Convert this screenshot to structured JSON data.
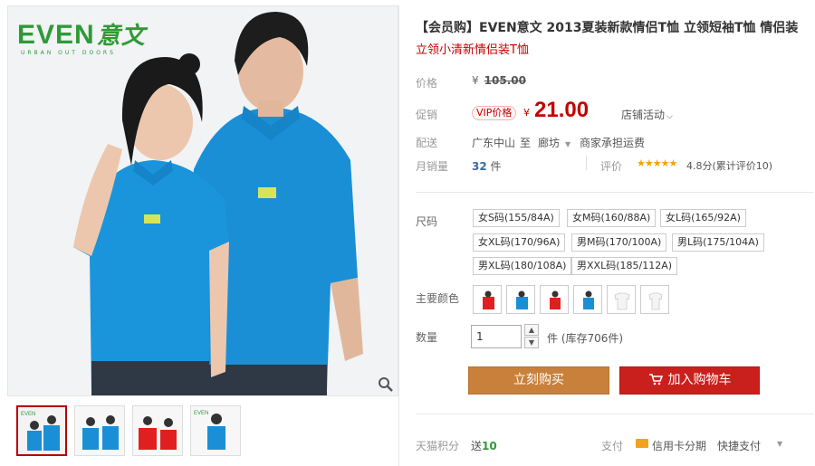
{
  "gallery": {
    "brand_logo": "EVEN",
    "brand_logo_cn": "意文",
    "brand_sub": "URBAN OUT DOORS"
  },
  "product": {
    "title": "【会员购】EVEN意文 2013夏装新款情侣T恤 立领短袖T恤 情侣装",
    "subtitle": "立领小清新情侣装T恤"
  },
  "price": {
    "label": "价格",
    "currency": "¥",
    "original": "105.00",
    "promo_label": "促销",
    "vip_badge": "VIP价格",
    "vip_currency": "¥",
    "current": "21.00",
    "promo_dropdown": "店铺活动"
  },
  "shipping": {
    "label": "配送",
    "from": "广东中山",
    "to_word": "至",
    "to": "廊坊",
    "carrier": "商家承担运费"
  },
  "sales": {
    "label": "月销量",
    "count": "32",
    "unit": "件",
    "review_label": "评价",
    "stars": "★★★★★",
    "rating_text": "4.8分(累计评价10)"
  },
  "size": {
    "label": "尺码",
    "options": [
      "女S码(155/84A)",
      "女M码(160/88A)",
      "女L码(165/92A)",
      "女XL码(170/96A)",
      "男M码(170/100A)",
      "男L码(175/104A)",
      "男XL码(180/108A)",
      "男XXL码(185/112A)"
    ]
  },
  "color": {
    "label": "主要颜色",
    "swatches": [
      "red-male",
      "blue-male",
      "red-female",
      "blue-female",
      "white-male",
      "white-female"
    ]
  },
  "quantity": {
    "label": "数量",
    "value": "1",
    "stock_text": "件 (库存706件)"
  },
  "actions": {
    "buy_now": "立刻购买",
    "add_to_cart": "加入购物车"
  },
  "footer": {
    "points_label": "天猫积分",
    "points_prefix": "送",
    "points_value": "10",
    "payment_label": "支付",
    "credit_card": "信用卡分期",
    "quick_pay": "快捷支付"
  },
  "colors": {
    "accent_red": "#c40000",
    "shirt_blue": "#1a8fd6",
    "brand_green": "#2f9a37",
    "buy_button": "#c8803b",
    "cart_button": "#c9201d"
  }
}
